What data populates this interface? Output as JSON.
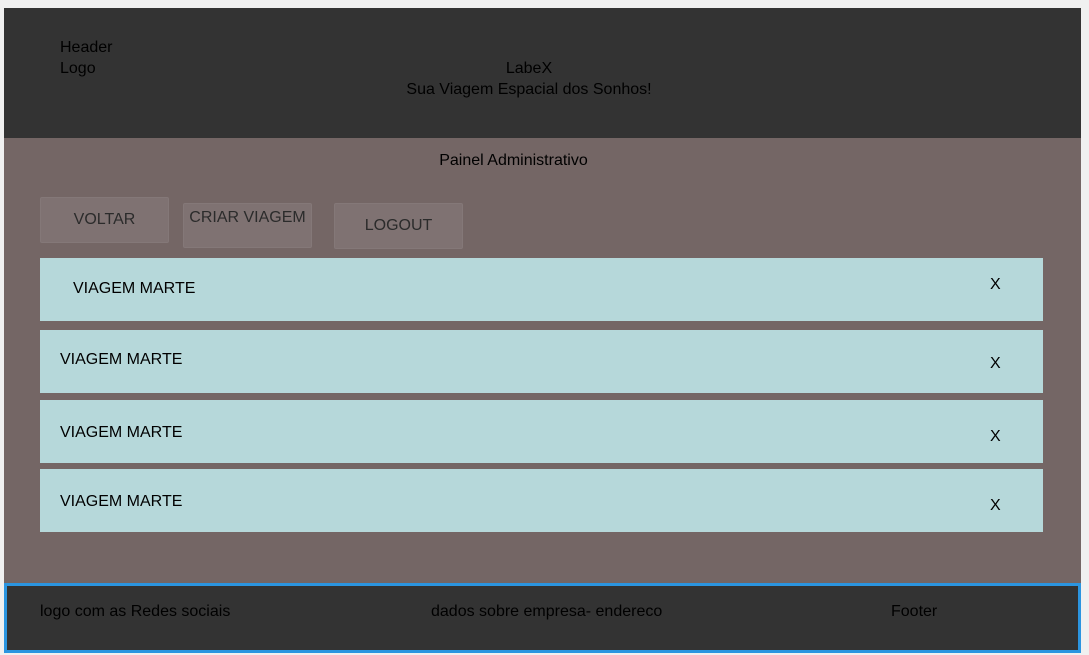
{
  "header": {
    "label": "Header",
    "logo": "Logo",
    "brand": "LabeX",
    "tagline": "Sua Viagem Espacial dos Sonhos!"
  },
  "main": {
    "title": "Painel Administrativo",
    "buttons": {
      "back": "VOLTAR",
      "create_trip": "CRIAR VIAGEM",
      "logout": "LOGOUT"
    },
    "trips": [
      {
        "name": "VIAGEM MARTE",
        "delete": "X"
      },
      {
        "name": "VIAGEM MARTE",
        "delete": "X"
      },
      {
        "name": "VIAGEM MARTE",
        "delete": "X"
      },
      {
        "name": "VIAGEM MARTE",
        "delete": "X"
      }
    ]
  },
  "footer": {
    "social": "logo com as Redes sociais",
    "company": "dados sobre empresa- endereco",
    "label": "Footer"
  },
  "colors": {
    "header_bg": "#333333",
    "main_bg": "#746665",
    "card_bg": "#b6d8da",
    "footer_border": "#2b95e0"
  }
}
